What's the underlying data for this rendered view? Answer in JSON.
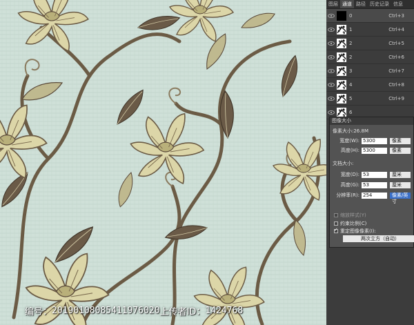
{
  "watermark": {
    "id_label": "编号：",
    "id_value": "20190108085411976020",
    "uploader_label": " 上传者ID：",
    "uploader_value": "1424768"
  },
  "panel": {
    "tabs": [
      "图层",
      "通道",
      "路径",
      "历史记录",
      "信息"
    ],
    "active_tab": 1,
    "channels": [
      {
        "name": "0",
        "shortcut": "Ctrl+3",
        "thumb": "black"
      },
      {
        "name": "1",
        "shortcut": "Ctrl+4",
        "thumb": "pattern"
      },
      {
        "name": "2",
        "shortcut": "Ctrl+5",
        "thumb": "pattern"
      },
      {
        "name": "2",
        "shortcut": "Ctrl+6",
        "thumb": "pattern"
      },
      {
        "name": "3",
        "shortcut": "Ctrl+7",
        "thumb": "pattern"
      },
      {
        "name": "4",
        "shortcut": "Ctrl+8",
        "thumb": "pattern"
      },
      {
        "name": "5",
        "shortcut": "Ctrl+9",
        "thumb": "pattern"
      },
      {
        "name": "6",
        "shortcut": "",
        "thumb": "pattern"
      }
    ]
  },
  "dialog": {
    "title": "图像大小",
    "pixel_dimensions": "像素大小:26.8M",
    "width_label": "宽度(W):",
    "width_value": "5300",
    "width_unit": "像素",
    "height_label": "高度(H):",
    "height_value": "5300",
    "height_unit": "像素",
    "doc_size": "文档大小:",
    "doc_width_label": "宽度(D):",
    "doc_width_value": "53",
    "doc_width_unit": "厘米",
    "doc_height_label": "高度(G):",
    "doc_height_value": "53",
    "doc_height_unit": "厘米",
    "resolution_label": "分辨率(R):",
    "resolution_value": "254",
    "resolution_unit": "像素/英寸",
    "scale_styles": "缩放样式(Y)",
    "constrain": "约束比例(C)",
    "resample": "重定图像像素(I):",
    "resample_method": "两次立方（自动）"
  },
  "colors": {
    "canvas_bg": "#cfe0d8",
    "flower": "#d9d3a5",
    "stem": "#6b5b45",
    "leaf_dark": "#5a4a3a",
    "panel_bg": "#3c3c3c",
    "highlight": "#3a6fc8"
  }
}
